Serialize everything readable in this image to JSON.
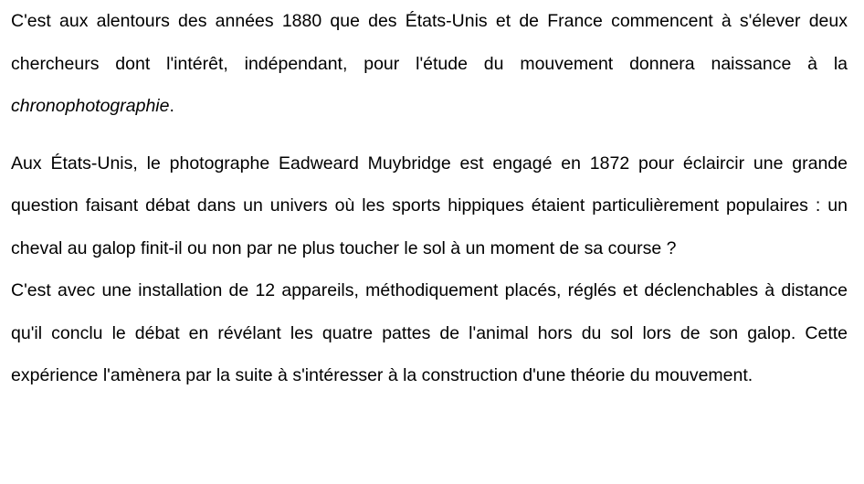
{
  "document": {
    "paragraph_1": {
      "text_before": "C'est aux alentours des années 1880 que des États-Unis et de France commencent à s'élever deux chercheurs dont l'intérêt, indépendant, pour l'étude du mouvement donnera naissance à la ",
      "emphasis": "chronophotographie",
      "text_after": "."
    },
    "paragraph_2": "Aux États-Unis, le photographe Eadweard Muybridge est engagé en 1872 pour éclaircir une grande question faisant débat dans un univers où les sports hippiques étaient particulièrement populaires : un cheval au galop finit-il ou non par ne plus toucher le sol à un moment de sa course ?",
    "paragraph_3": "C'est avec une installation de 12 appareils, méthodiquement placés, réglés et déclenchables à distance qu'il conclu le débat en révélant les quatre pattes de l'animal hors du sol lors de son galop. Cette expérience l'amènera par la suite à s'intéresser à la construction d'une théorie du mouvement."
  }
}
